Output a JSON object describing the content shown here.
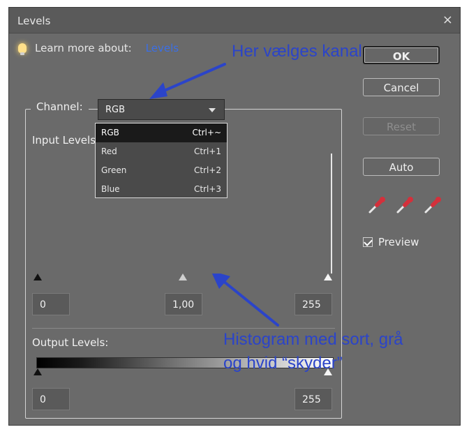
{
  "window": {
    "title": "Levels",
    "close_glyph": "×"
  },
  "learn_more": {
    "label": "Learn more about:",
    "link_text": "Levels",
    "icon": "lightbulb-icon"
  },
  "annotations": {
    "channel_note": "Her vælges kanal",
    "histogram_note_line1": "Histogram med sort, grå",
    "histogram_note_line2": "og hvid “skyder”"
  },
  "buttons": {
    "ok": "OK",
    "cancel": "Cancel",
    "reset": "Reset",
    "auto": "Auto"
  },
  "channel": {
    "label": "Channel:",
    "selected": "RGB",
    "options": [
      {
        "label": "RGB",
        "shortcut": "Ctrl+~"
      },
      {
        "label": "Red",
        "shortcut": "Ctrl+1"
      },
      {
        "label": "Green",
        "shortcut": "Ctrl+2"
      },
      {
        "label": "Blue",
        "shortcut": "Ctrl+3"
      }
    ]
  },
  "input_levels": {
    "label": "Input Levels:",
    "black": "0",
    "gamma": "1,00",
    "white": "255"
  },
  "output_levels": {
    "label": "Output Levels:",
    "black": "0",
    "white": "255"
  },
  "preview": {
    "label": "Preview",
    "checked": true
  },
  "colors": {
    "dialog_bg": "#6a6a6a",
    "annotation_blue": "#2b44c9",
    "link_blue": "#3b6fe6"
  }
}
